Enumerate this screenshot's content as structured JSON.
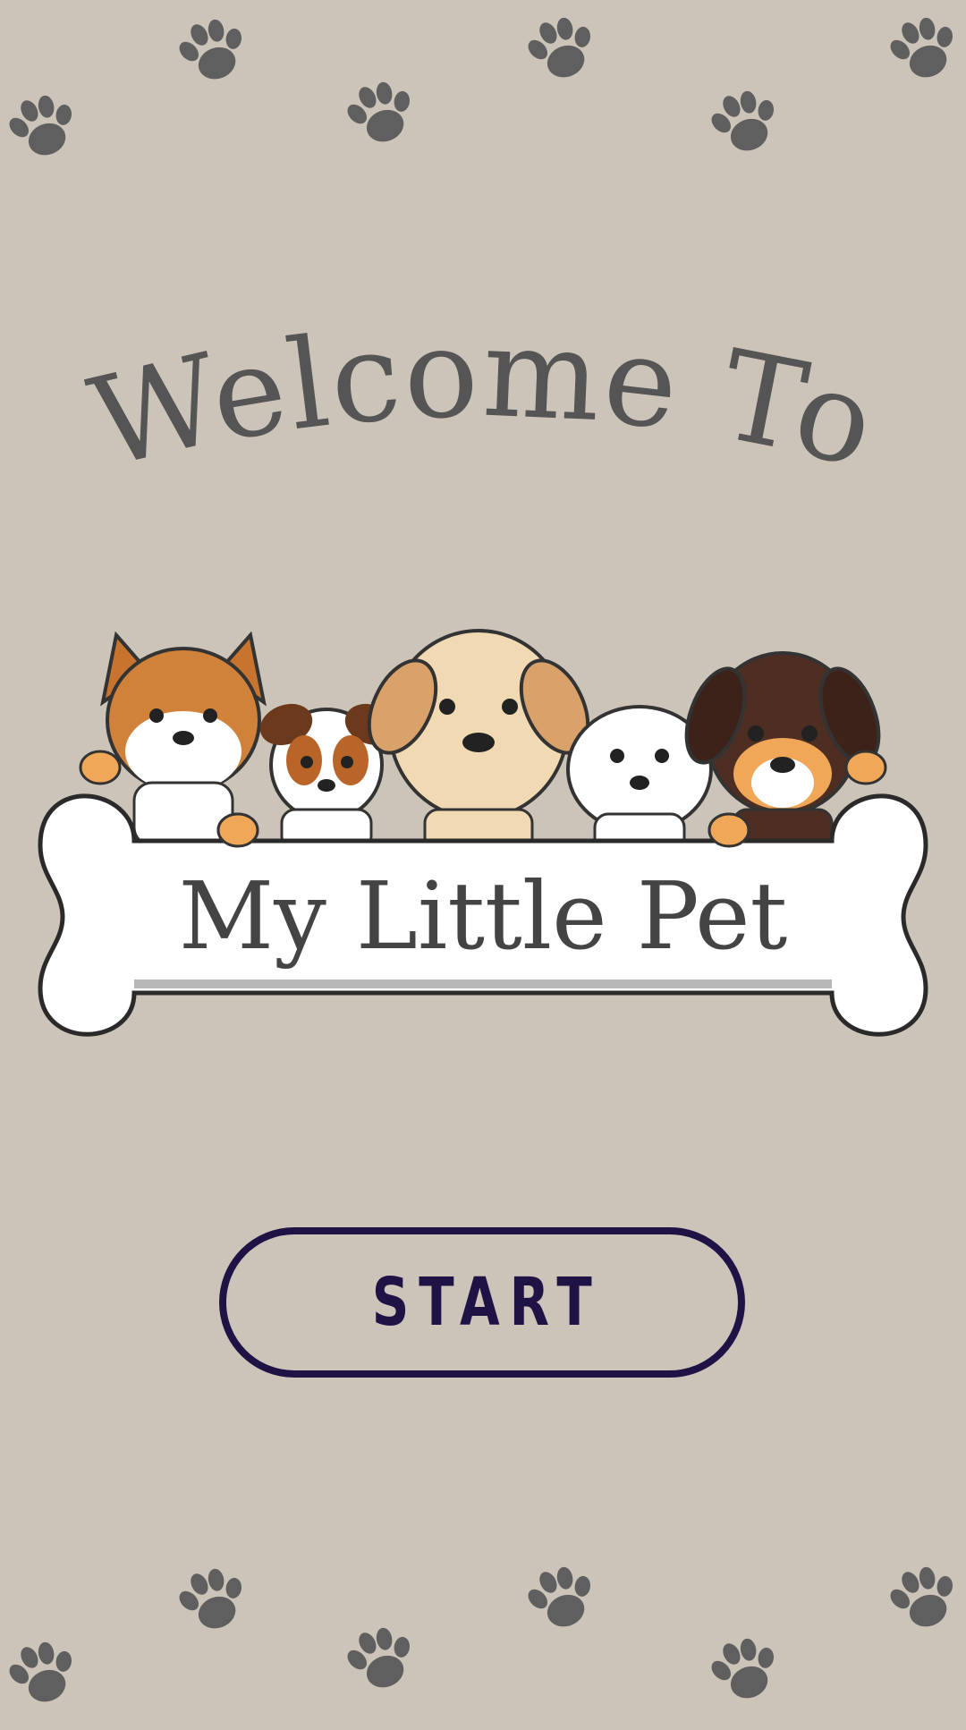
{
  "screen": {
    "welcome_text": "Welcome To",
    "logo_text": "My Little Pet",
    "start_label": "START"
  },
  "icons": {
    "decoration": "paw-print-icon",
    "logo_art": "puppies-on-bone-illustration"
  },
  "colors": {
    "background": "#cdc4b9",
    "paw": "#5f5f5f",
    "welcome_text": "#555555",
    "logo_text": "#444444",
    "button_border": "#1f1346",
    "button_text": "#1f1346"
  }
}
